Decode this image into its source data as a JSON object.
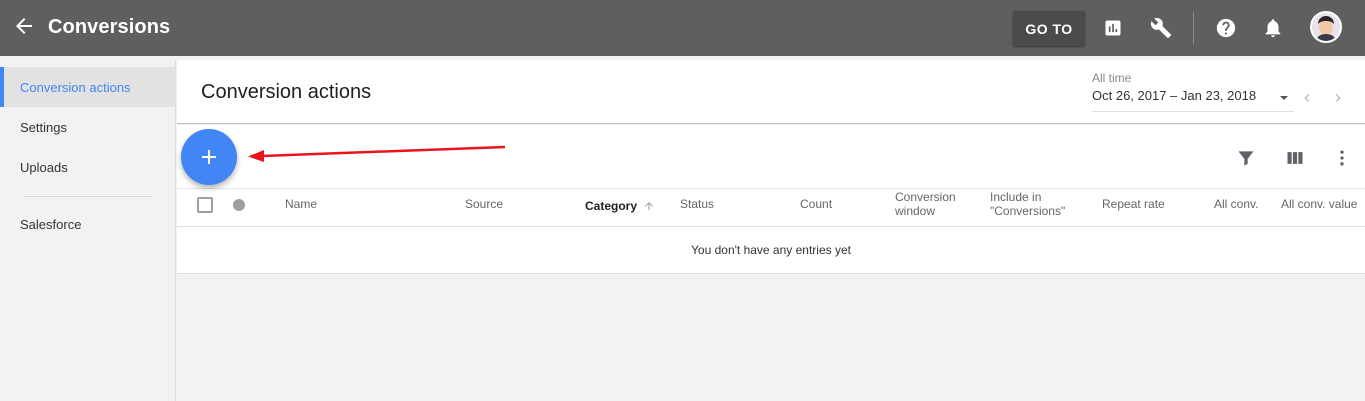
{
  "topbar": {
    "title": "Conversions",
    "goto_label": "GO TO",
    "icons": [
      "back-arrow-icon",
      "reports-icon",
      "tools-icon",
      "help-icon",
      "notifications-icon",
      "avatar"
    ]
  },
  "sidebar": {
    "items": [
      {
        "label": "Conversion actions",
        "active": true
      },
      {
        "label": "Settings",
        "active": false
      },
      {
        "label": "Uploads",
        "active": false
      },
      {
        "label": "Salesforce",
        "active": false
      }
    ]
  },
  "main": {
    "title": "Conversion actions",
    "date": {
      "label": "All time",
      "range": "Oct 26, 2017 – Jan 23, 2018"
    }
  },
  "toolbar": {
    "icons": [
      "add-icon",
      "filter-icon",
      "columns-icon",
      "more-vert-icon"
    ]
  },
  "table": {
    "columns": {
      "name": "Name",
      "source": "Source",
      "category": "Category",
      "status": "Status",
      "count": "Count",
      "conv_window_1": "Conversion",
      "conv_window_2": "window",
      "include_1": "Include in",
      "include_2": "\"Conversions\"",
      "repeat_rate": "Repeat rate",
      "all_conv": "All conv.",
      "all_conv_value": "All conv. value"
    },
    "sorted_column": "Category",
    "empty_message": "You don't have any entries yet"
  },
  "colors": {
    "topbar": "#5f5f5f",
    "accent": "#4285f4",
    "annotation": "#e8141b"
  }
}
